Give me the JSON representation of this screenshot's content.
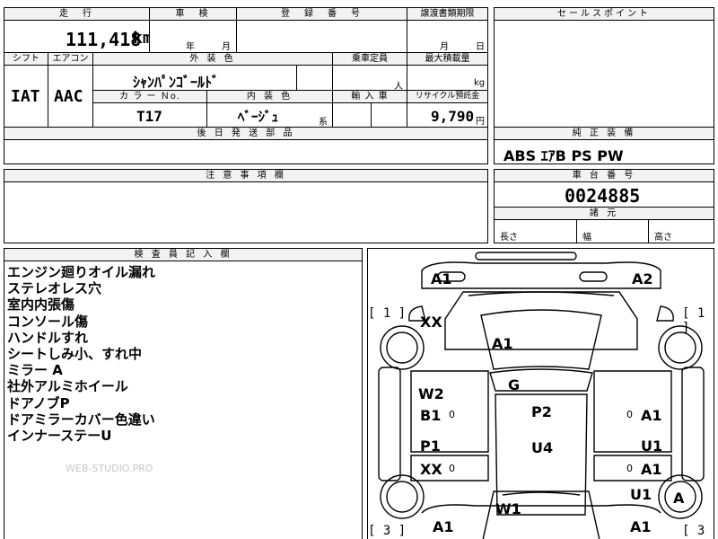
{
  "top_header": {
    "mileage_label": "走　行",
    "inspection_label": "車　検",
    "registration_label": "登　録　番　号",
    "transfer_label": "譲渡書類期限",
    "sales_point_label": "セールスポイント"
  },
  "mileage": {
    "value": "111,418",
    "unit": "km"
  },
  "inspection": {
    "year_label": "年",
    "month_label": "月"
  },
  "transfer": {
    "month_label": "月",
    "day_label": "日"
  },
  "spec_header": {
    "shift": "シフト",
    "aircon": "エアコン",
    "exterior_color": "外 装 色",
    "capacity": "乗車定員",
    "max_load": "最大積載量"
  },
  "spec": {
    "shift": "IAT",
    "aircon": "AAC",
    "exterior_color": "ｼｬﾝﾊﾟﾝｺﾞｰﾙﾄﾞ",
    "capacity_unit": "人",
    "load_unit": "kg"
  },
  "spec_header2": {
    "color_no": "カ ラ ー Ｎo.",
    "interior_color": "内 装 色",
    "import": "輸 入 車",
    "recycle": "リサイクル預託金"
  },
  "spec2": {
    "color_no": "T17",
    "interior_color": "ﾍﾞｰｼﾞｭ",
    "interior_suffix": "系",
    "recycle_value": "9,790",
    "recycle_unit": "円"
  },
  "deferred": {
    "label": "後 日 発 送 部 品"
  },
  "equipment": {
    "label": "純 正 装 備",
    "value": "ABS ｴｱB PS PW"
  },
  "caution": {
    "label": "注 意 事 項 欄"
  },
  "chassis": {
    "label": "車 台 番 号",
    "value": "0024885"
  },
  "dimensions": {
    "label": "諸 元",
    "length": "長さ",
    "width": "幅",
    "height": "高さ"
  },
  "inspector": {
    "label": "検 査 員 記 入 欄",
    "notes": [
      "エンジン廻りオイル漏れ",
      "ステレオレス穴",
      "室内内張傷",
      "コンソール傷",
      "ハンドルすれ",
      "シートしみ小、すれ中",
      "ミラー A",
      "社外アルミホイール",
      "ドアノブP",
      "ドアミラーカバー色違い",
      "インナーステーU"
    ],
    "watermark": "WEB-STUDIO.PRO"
  },
  "diagram": {
    "marks": {
      "front_left": "A1",
      "front_right": "A2",
      "hood": "XX",
      "windshield": "A1",
      "roof": "G",
      "fl_door_upper": "W2",
      "fl_door_lower": "B1",
      "rl_door_upper": "P1",
      "rl_door_lower": "XX",
      "roof_mid": "P2",
      "roof_rear": "U4",
      "fr_door": "A1",
      "rr_door_upper": "U1",
      "rr_door_lower": "A1",
      "rear_right": "U1",
      "rear_window": "W1",
      "rear_left": "A1",
      "rear_right_bottom": "A1",
      "wheel_rr": "A",
      "small_zero": "0"
    },
    "brackets": {
      "front_left": "[ 1 ]",
      "front_right": "[ 1 ]",
      "rear_left": "[ 3 ]",
      "rear_right": "[ 3 ]"
    }
  }
}
